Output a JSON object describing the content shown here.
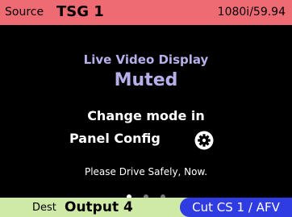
{
  "source_bar": {
    "label": "Source",
    "value": "TSG 1",
    "format": "1080i/59.94",
    "color": "#ef6b74"
  },
  "display": {
    "title": "Live Video Display",
    "state": "Muted",
    "hint_line1": "Change mode in",
    "hint_line2": "Panel Config",
    "settings_icon": "gear-icon",
    "tagline": "Please Drive Safely, Now.",
    "accent_color": "#b5b0ea"
  },
  "pager": {
    "page_count": 3,
    "current_page": 1
  },
  "dest_bar": {
    "label": "Dest",
    "value": "Output 4",
    "action": "Cut CS 1 / AFV",
    "color": "#cfe9a6",
    "action_color": "#2f3ce2"
  }
}
